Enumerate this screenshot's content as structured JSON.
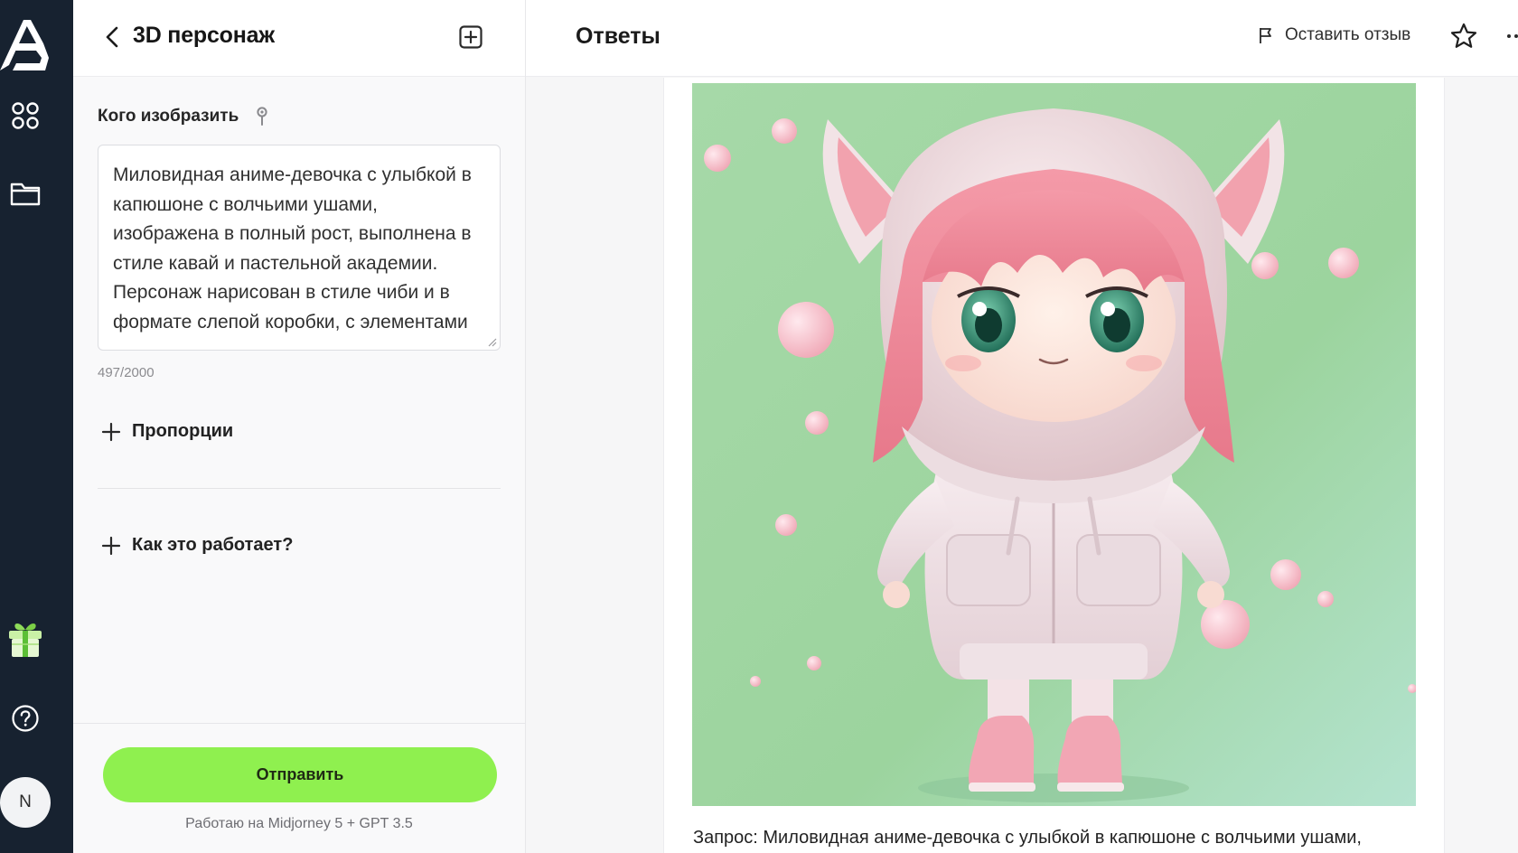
{
  "colors": {
    "rail_bg": "#172230",
    "accent_green": "#8ff04f",
    "image_bg": "#a9dfae"
  },
  "rail": {
    "icons": [
      "logo-icon",
      "apps-grid-icon",
      "folder-icon",
      "gift-icon",
      "help-icon"
    ],
    "avatar_initial": "N"
  },
  "panel": {
    "title": "3D персонаж",
    "field_label": "Кого изобразить",
    "prompt_text": "Миловидная аниме-девочка с улыбкой в капюшоне с волчьими ушами, изображена в полный рост, выполнена в стиле кавай и пастельной академии. Персонаж нарисован в стиле чиби и в формате слепой коробки, с элементами",
    "char_count": "497/2000",
    "expanders": [
      {
        "label": "Пропорции"
      },
      {
        "label": "Как это работает?"
      }
    ],
    "submit_label": "Отправить",
    "powered_by": "Работаю на Midjorney 5 + GPT 3.5"
  },
  "answers": {
    "title": "Ответы",
    "feedback_label": "Оставить отзыв",
    "query_text": "Запрос: Миловидная аниме-девочка с улыбкой в капюшоне с волчьими ушами,"
  }
}
